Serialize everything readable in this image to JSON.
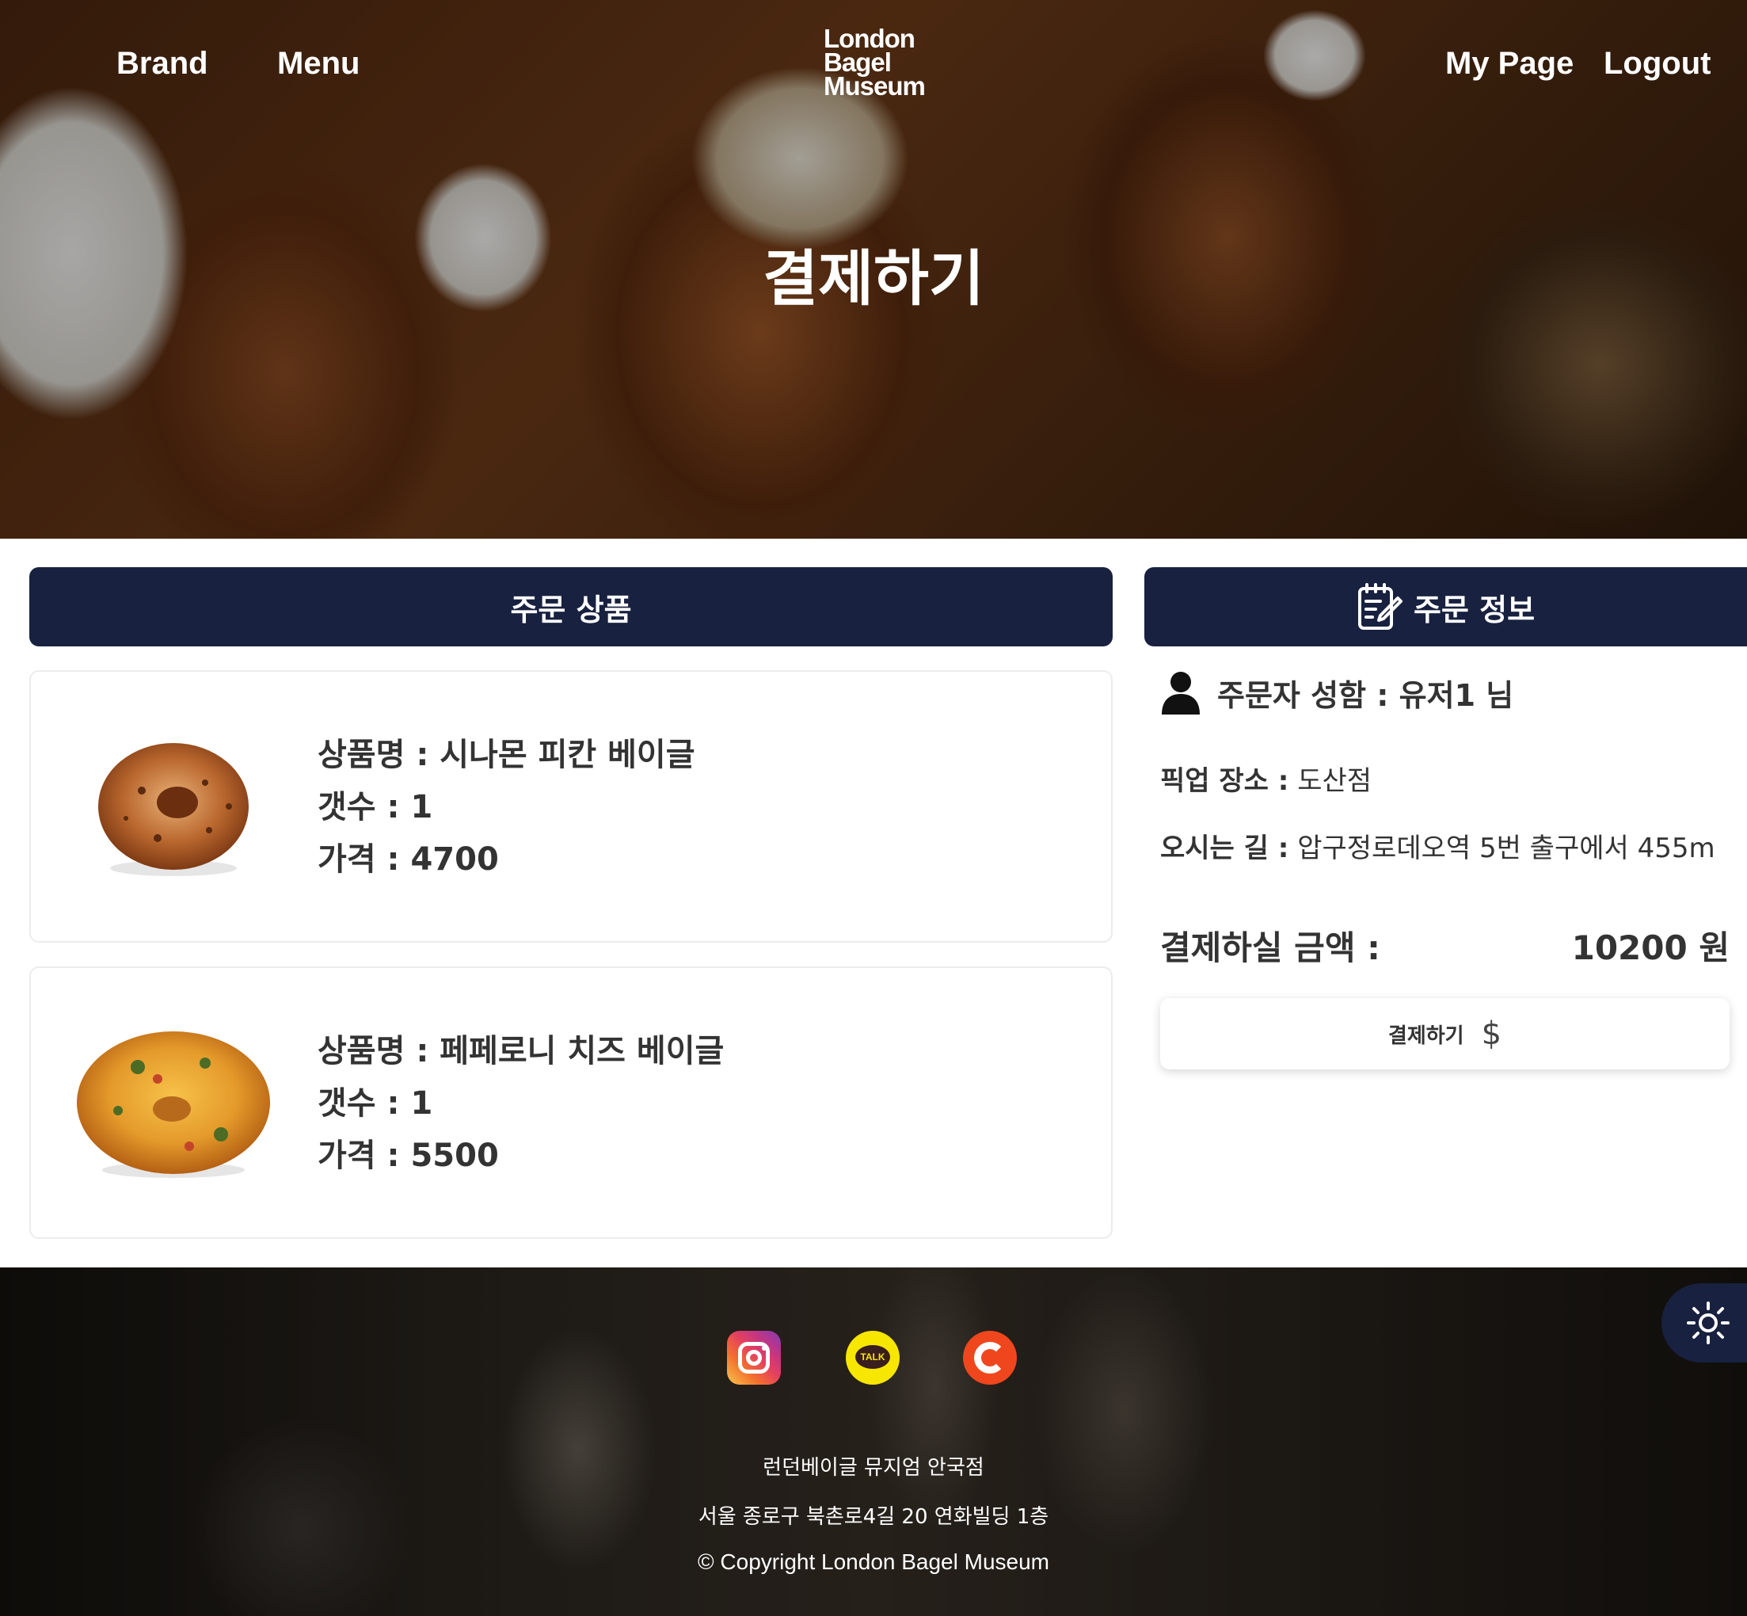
{
  "nav": {
    "brand": "Brand",
    "menu": "Menu",
    "logo_lines": [
      "London",
      "Bagel",
      "Museum"
    ],
    "my_page": "My Page",
    "logout": "Logout"
  },
  "hero": {
    "title": "결제하기"
  },
  "order_items": {
    "header": "주문 상품",
    "items": [
      {
        "name_line": "상품명 : 시나몬 피칸 베이글",
        "qty_line": "갯수 : 1",
        "price_line": "가격 : 4700"
      },
      {
        "name_line": "상품명 : 페페로니 치즈 베이글",
        "qty_line": "갯수 : 1",
        "price_line": "가격 : 5500"
      }
    ]
  },
  "order_info": {
    "header": "주문 정보",
    "orderer": "주문자 성함 : 유저1 님",
    "pickup_label": "픽업 장소 :",
    "pickup_value": " 도산점",
    "route_label": "오시는 길 :",
    "route_value": " 압구정로데오역 5번 출구에서 455m",
    "pay_label": "결제하실 금액 :",
    "pay_amount": "10200 원",
    "pay_button": "결제하기",
    "pay_button_symbol": "$"
  },
  "footer": {
    "kakao_label": "TALK",
    "store_name": "런던베이글 뮤지엄 안국점",
    "address": "서울 종로구 북촌로4길 20 연화빌딩 1층",
    "copyright": "© Copyright London Bagel Museum"
  },
  "icons": {
    "order_info_icon": "notepad-pencil-icon",
    "orderer_icon": "user-icon",
    "theme_toggle_icon": "sun-icon",
    "socials": [
      "instagram-icon",
      "kakaotalk-icon",
      "catchtable-icon"
    ]
  },
  "colors": {
    "navy": "#18213f",
    "kakao_yellow": "#f7e600",
    "catch_red": "#f0461d"
  }
}
